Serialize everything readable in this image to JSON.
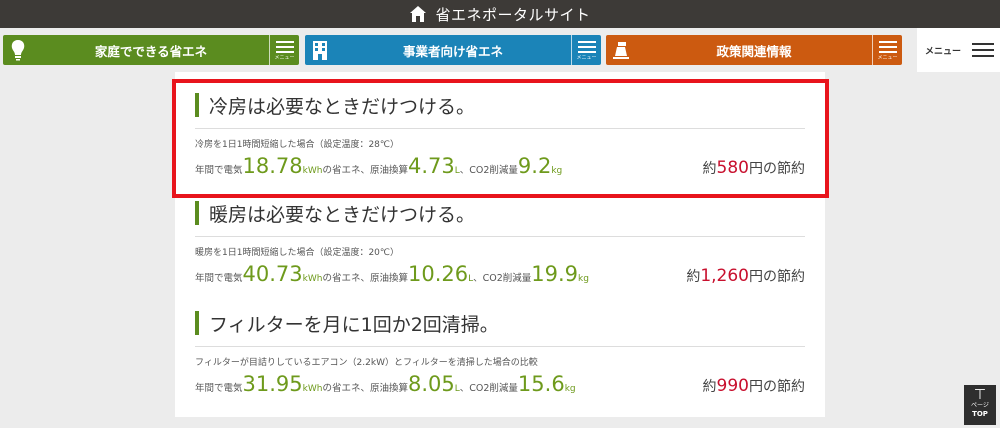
{
  "header": {
    "title": "省エネポータルサイト",
    "home_icon": "home-icon"
  },
  "nav": [
    {
      "label": "家庭でできる省エネ",
      "icon": "lightbulb-icon",
      "menu": "メニュー",
      "color": "#5b8c1f"
    },
    {
      "label": "事業者向け省エネ",
      "icon": "building-icon",
      "menu": "メニュー",
      "color": "#1b84b8"
    },
    {
      "label": "政策関連情報",
      "icon": "policy-icon",
      "menu": "メニュー",
      "color": "#cc5a10"
    }
  ],
  "menu_all": {
    "label": "メニュー",
    "icon": "hamburger-icon"
  },
  "items": [
    {
      "heading": "冷房は必要なときだけつける。",
      "note": "冷房を1日1時間短縮した場合（設定温度：28℃）",
      "prefix": "年間で電気",
      "kwh": "18.78",
      "kwh_unit": "kWh",
      "mid1": "の省エネ、原油換算",
      "oil": "4.73",
      "oil_unit": "L",
      "mid2": "、CO2削減量",
      "co2": "9.2",
      "co2_unit": "kg",
      "saving_prefix": "約",
      "saving": "580",
      "saving_suffix": "円の節約"
    },
    {
      "heading": "暖房は必要なときだけつける。",
      "note": "暖房を1日1時間短縮した場合（設定温度：20℃）",
      "prefix": "年間で電気",
      "kwh": "40.73",
      "kwh_unit": "kWh",
      "mid1": "の省エネ、原油換算",
      "oil": "10.26",
      "oil_unit": "L",
      "mid2": "、CO2削減量",
      "co2": "19.9",
      "co2_unit": "kg",
      "saving_prefix": "約",
      "saving": "1,260",
      "saving_suffix": "円の節約"
    },
    {
      "heading": "フィルターを月に1回か2回清掃。",
      "note": "フィルターが目詰りしているエアコン（2.2kW）とフィルターを清掃した場合の比較",
      "prefix": "年間で電気",
      "kwh": "31.95",
      "kwh_unit": "kWh",
      "mid1": "の省エネ、原油換算",
      "oil": "8.05",
      "oil_unit": "L",
      "mid2": "、CO2削減量",
      "co2": "15.6",
      "co2_unit": "kg",
      "saving_prefix": "約",
      "saving": "990",
      "saving_suffix": "円の節約"
    }
  ],
  "pagetop": {
    "line1": "ページ",
    "line2": "TOP",
    "icon": "arrow-up-icon"
  },
  "colors": {
    "accent_green": "#6e9a1c",
    "saving_red": "#c8102e",
    "highlight_red": "#e8141c"
  }
}
